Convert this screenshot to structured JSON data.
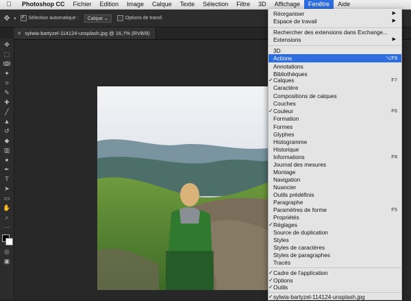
{
  "menubar": {
    "app": "Photoshop CC",
    "items": [
      "Fichier",
      "Edition",
      "Image",
      "Calque",
      "Texte",
      "Sélection",
      "Filtre",
      "3D",
      "Affichage",
      "Fenêtre",
      "Aide"
    ],
    "active": "Fenêtre"
  },
  "options": {
    "auto_select": "Sélection automatique :",
    "target": "Calque",
    "transform": "Options de transf."
  },
  "doc_tab": {
    "title": "sylwia-bartyzel-114124-unsplash.jpg @ 16,7% (RVB/8)"
  },
  "window_menu": {
    "items": [
      {
        "label": "Réorganiser",
        "submenu": true
      },
      {
        "label": "Espace de travail",
        "submenu": true
      },
      {
        "label": "Rechercher des extensions dans Exchange..."
      },
      {
        "label": "Extensions",
        "submenu": true
      },
      {
        "label": "3D"
      },
      {
        "label": "Actions",
        "shortcut": "⌥F9",
        "highlighted": true
      },
      {
        "label": "Annotations"
      },
      {
        "label": "Bibliothèques"
      },
      {
        "label": "Calques",
        "checked": true,
        "shortcut": "F7"
      },
      {
        "label": "Caractère"
      },
      {
        "label": "Compositions de calques"
      },
      {
        "label": "Couches"
      },
      {
        "label": "Couleur",
        "checked": true,
        "shortcut": "F6"
      },
      {
        "label": "Formation"
      },
      {
        "label": "Formes"
      },
      {
        "label": "Glyphes"
      },
      {
        "label": "Histogramme"
      },
      {
        "label": "Historique"
      },
      {
        "label": "Informations",
        "shortcut": "F8"
      },
      {
        "label": "Journal des mesures"
      },
      {
        "label": "Montage"
      },
      {
        "label": "Navigation"
      },
      {
        "label": "Nuancier"
      },
      {
        "label": "Outils prédéfinis"
      },
      {
        "label": "Paragraphe"
      },
      {
        "label": "Paramètres de forme",
        "shortcut": "F5"
      },
      {
        "label": "Propriétés"
      },
      {
        "label": "Réglages",
        "checked": true
      },
      {
        "label": "Source de duplication"
      },
      {
        "label": "Styles"
      },
      {
        "label": "Styles de caractères"
      },
      {
        "label": "Styles de paragraphes"
      },
      {
        "label": "Tracés"
      },
      {
        "label": "Cadre de l'application",
        "checked": true
      },
      {
        "label": "Options",
        "checked": true
      },
      {
        "label": "Outils",
        "checked": true
      },
      {
        "label": "sylwia-bartyzel-114124-unsplash.jpg",
        "checked": true
      }
    ]
  },
  "colors": {
    "highlight": "#2d6de0",
    "foreground": "#000000",
    "background": "#ffffff"
  }
}
